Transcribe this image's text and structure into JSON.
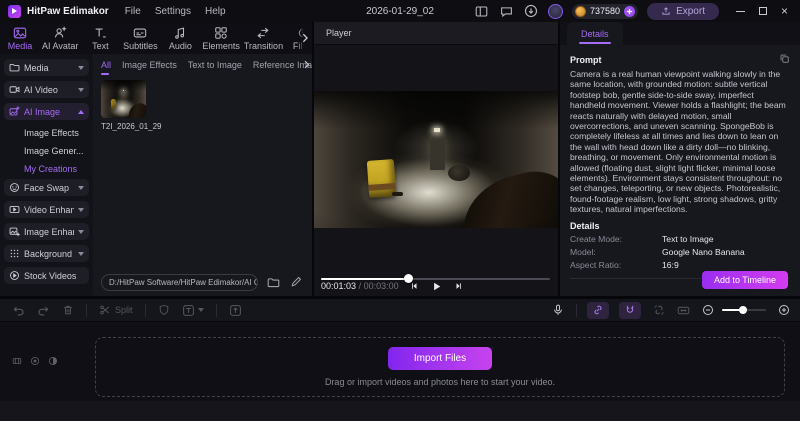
{
  "titlebar": {
    "app_name": "HitPaw Edimakor",
    "menus": [
      "File",
      "Settings",
      "Help"
    ],
    "project_title": "2026-01-29_02",
    "credits": "737580",
    "export_label": "Export"
  },
  "ribbon": {
    "tabs": [
      "Media",
      "AI Avatar",
      "Text",
      "Subtitles",
      "Audio",
      "Elements",
      "Transition",
      "Filters"
    ],
    "active_tab": "Media"
  },
  "sidebar": {
    "items": [
      {
        "label": "Media"
      },
      {
        "label": "AI Video"
      },
      {
        "label": "AI Image",
        "active": true,
        "expanded": true
      },
      {
        "label": "Image Effects",
        "sub": true
      },
      {
        "label": "Image Gener...",
        "sub": true
      },
      {
        "label": "My Creations",
        "sub": true,
        "active": true
      },
      {
        "label": "Face Swap"
      },
      {
        "label": "Video Enhance"
      },
      {
        "label": "Image Enhance"
      },
      {
        "label": "Background"
      },
      {
        "label": "Stock Videos"
      }
    ]
  },
  "media_panel": {
    "tabs": [
      "All",
      "Image Effects",
      "Text to Image",
      "Reference Image"
    ],
    "active_tab": "All",
    "items": [
      {
        "name": "T2I_2026_01_29"
      }
    ],
    "path": "D:/HitPaw Software/HitPaw Edimakor/AI Ge..."
  },
  "player": {
    "title": "Player",
    "current_time": "00:01:03",
    "duration": "00:03:00",
    "time_separator": "/",
    "progress_percent": 38
  },
  "details_panel": {
    "tab_label": "Details",
    "prompt_label": "Prompt",
    "prompt_text": "Camera is a real human viewpoint walking slowly in the same location, with grounded motion: subtle vertical footstep bob, gentle side-to-side sway, imperfect handheld movement. Viewer holds a flashlight; the beam reacts naturally with delayed motion, small overcorrections, and uneven scanning. SpongeBob is completely lifeless at all times and lies down to lean on the wall with head down like a dirty doll—no blinking, breathing, or movement. Only environmental motion is allowed (floating dust, slight light flicker, minimal loose elements). Environment stays consistent throughout: no set changes, teleporting, or new objects. Photorealistic, found-footage realism, low light, strong shadows, gritty textures, natural imperfections.",
    "section_label": "Details",
    "fields": [
      {
        "label": "Create Mode:",
        "value": "Text to Image"
      },
      {
        "label": "Model:",
        "value": "Google Nano Banana"
      },
      {
        "label": "Aspect Ratio:",
        "value": "16:9"
      }
    ],
    "add_button_label": "Add to Timeline"
  },
  "toolbar": {
    "split_label": "Split",
    "zoom_percent": 48
  },
  "timeline": {
    "import_button_label": "Import Files",
    "import_hint": "Drag or import videos and photos here to start your video."
  },
  "colors": {
    "accent": "#a56cf5",
    "button_gradient_start": "#8226ee",
    "button_gradient_end": "#c643ee",
    "coin": "#e8a33d",
    "background": "#0f0f15",
    "panel": "#17171e"
  }
}
